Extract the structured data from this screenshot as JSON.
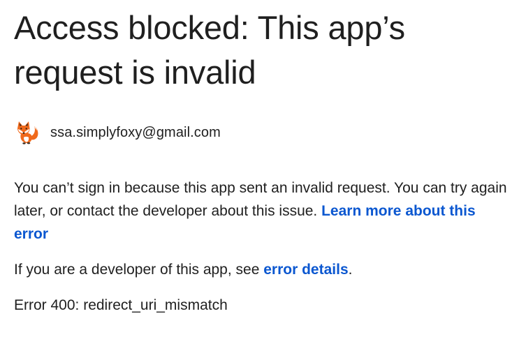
{
  "page": {
    "title": "Access blocked: This app’s request is invalid",
    "account": {
      "email": "ssa.simplyfoxy@gmail.com",
      "avatar_icon": "fox-avatar-icon"
    },
    "message": {
      "text": "You can’t sign in because this app sent an invalid request. You can try again later, or contact the developer about this issue. ",
      "learn_more_link": "Learn more about this error"
    },
    "developer": {
      "prefix": "If you are a developer of this app, see ",
      "link": "error details",
      "suffix": "."
    },
    "error_code": "Error 400: redirect_uri_mismatch"
  },
  "colors": {
    "text": "#1f1f1f",
    "link": "#0b57d0",
    "fox_orange": "#f06a1c"
  }
}
